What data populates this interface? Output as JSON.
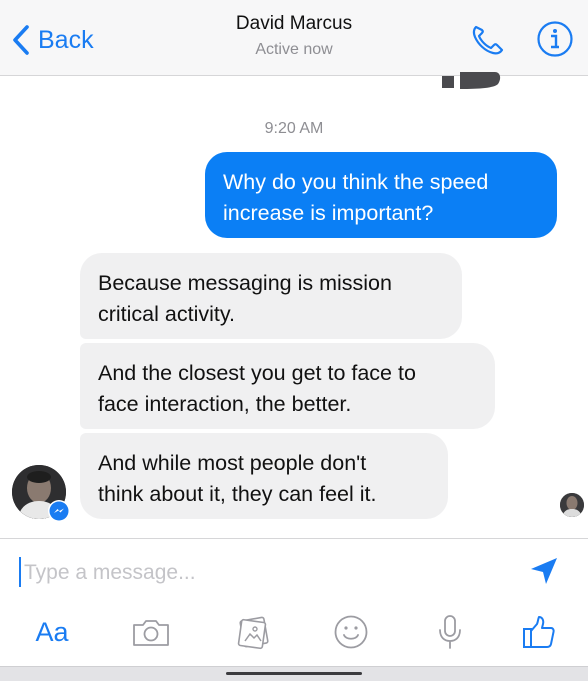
{
  "nav": {
    "back_label": "Back",
    "contact_name": "David Marcus",
    "status": "Active now",
    "accent_color": "#1a7cf2",
    "icons": [
      "chevron-left-icon",
      "phone-icon",
      "info-icon"
    ]
  },
  "conversation": {
    "timestamp": "9:20 AM",
    "outgoing": [
      {
        "lines": [
          "Why do you think the speed",
          "increase is important?"
        ]
      }
    ],
    "incoming": [
      {
        "lines": [
          "Because messaging is mission",
          "critical activity."
        ]
      },
      {
        "lines": [
          "And the closest you get to face to",
          "face interaction, the better."
        ]
      },
      {
        "lines": [
          "And while most people don't",
          "think about it, they can feel it."
        ]
      }
    ],
    "outgoing_color": "#0b7ff5",
    "incoming_color": "#f0f0f1"
  },
  "composer": {
    "placeholder": "Type a message...",
    "value": ""
  },
  "toolbar": {
    "text_label": "Aa",
    "icons": [
      "camera-icon",
      "gallery-icon",
      "emoji-icon",
      "microphone-icon",
      "thumbs-up-icon"
    ]
  }
}
